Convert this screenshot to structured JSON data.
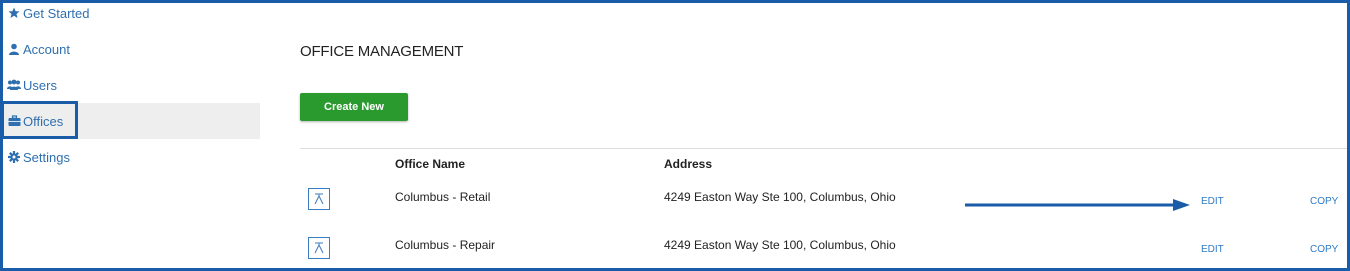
{
  "sidebar": {
    "items": [
      {
        "label": "Get Started",
        "icon": "star-icon"
      },
      {
        "label": "Account",
        "icon": "user-icon"
      },
      {
        "label": "Users",
        "icon": "users-icon"
      },
      {
        "label": "Offices",
        "icon": "briefcase-icon",
        "active": true
      },
      {
        "label": "Settings",
        "icon": "gear-icon"
      }
    ]
  },
  "main": {
    "title": "OFFICE MANAGEMENT",
    "create_label": "Create New",
    "columns": [
      "Office Name",
      "Address"
    ],
    "rows": [
      {
        "name": "Columbus - Retail",
        "address": "4249 Easton Way Ste 100, Columbus, Ohio",
        "edit": "EDIT",
        "copy": "COPY"
      },
      {
        "name": "Columbus - Repair",
        "address": "4249 Easton Way Ste 100, Columbus, Ohio",
        "edit": "EDIT",
        "copy": "COPY"
      }
    ]
  },
  "colors": {
    "accent": "#1a5ca8",
    "link": "#2f7ac4",
    "button": "#2a9a2e"
  }
}
